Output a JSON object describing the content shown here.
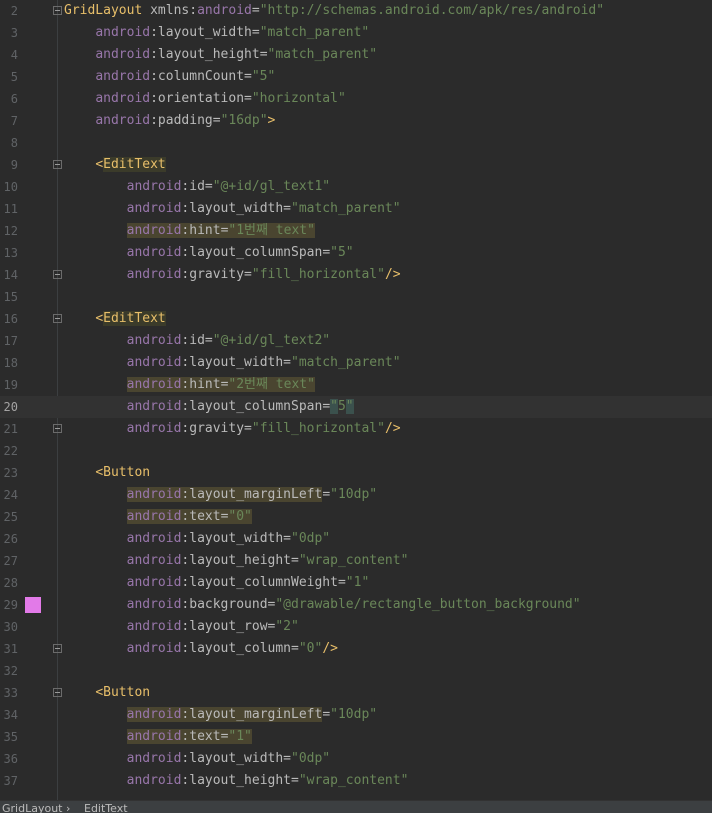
{
  "editor": {
    "lines": [
      {
        "n": "2",
        "fold": "open",
        "segs": [
          [
            "",
            "punc",
            "<"
          ],
          [
            "GridLayout",
            "tag",
            ""
          ],
          [
            " xmlns:",
            "attr",
            ""
          ],
          [
            "android",
            "ns",
            ""
          ],
          [
            "=",
            "attr",
            ""
          ],
          [
            "\"http://schemas.android.com/apk/res/android\"",
            "val",
            ""
          ]
        ]
      },
      {
        "n": "3",
        "segs": [
          [
            "    ",
            "",
            ""
          ],
          [
            "android",
            "ns",
            ""
          ],
          [
            ":layout_width",
            "attr",
            ""
          ],
          [
            "=",
            "attr",
            ""
          ],
          [
            "\"match_parent\"",
            "val",
            ""
          ]
        ]
      },
      {
        "n": "4",
        "segs": [
          [
            "    ",
            "",
            ""
          ],
          [
            "android",
            "ns",
            ""
          ],
          [
            ":layout_height",
            "attr",
            ""
          ],
          [
            "=",
            "attr",
            ""
          ],
          [
            "\"match_parent\"",
            "val",
            ""
          ]
        ]
      },
      {
        "n": "5",
        "segs": [
          [
            "    ",
            "",
            ""
          ],
          [
            "android",
            "ns",
            ""
          ],
          [
            ":columnCount",
            "attr",
            ""
          ],
          [
            "=",
            "attr",
            ""
          ],
          [
            "\"5\"",
            "val",
            ""
          ]
        ]
      },
      {
        "n": "6",
        "segs": [
          [
            "    ",
            "",
            ""
          ],
          [
            "android",
            "ns",
            ""
          ],
          [
            ":orientation",
            "attr",
            ""
          ],
          [
            "=",
            "attr",
            ""
          ],
          [
            "\"horizontal\"",
            "val",
            ""
          ]
        ]
      },
      {
        "n": "7",
        "segs": [
          [
            "    ",
            "",
            ""
          ],
          [
            "android",
            "ns",
            ""
          ],
          [
            ":padding",
            "attr",
            ""
          ],
          [
            "=",
            "attr",
            ""
          ],
          [
            "\"16dp\"",
            "val",
            ""
          ],
          [
            ">",
            "punc",
            ""
          ]
        ]
      },
      {
        "n": "8",
        "segs": []
      },
      {
        "n": "9",
        "fold": "open",
        "segs": [
          [
            "    ",
            "",
            ""
          ],
          [
            "<",
            "punc",
            ""
          ],
          [
            "EditText",
            "tag",
            "tag"
          ]
        ]
      },
      {
        "n": "10",
        "segs": [
          [
            "        ",
            "",
            ""
          ],
          [
            "android",
            "ns",
            ""
          ],
          [
            ":id",
            "attr",
            ""
          ],
          [
            "=",
            "attr",
            ""
          ],
          [
            "\"@+id/gl_text1\"",
            "val",
            ""
          ]
        ]
      },
      {
        "n": "11",
        "segs": [
          [
            "        ",
            "",
            ""
          ],
          [
            "android",
            "ns",
            ""
          ],
          [
            ":layout_width",
            "attr",
            ""
          ],
          [
            "=",
            "attr",
            ""
          ],
          [
            "\"match_parent\"",
            "val",
            ""
          ]
        ]
      },
      {
        "n": "12",
        "segs": [
          [
            "        ",
            "",
            ""
          ],
          [
            "android",
            "ns",
            "hl"
          ],
          [
            ":hint",
            "attr",
            "hl"
          ],
          [
            "=",
            "attr",
            "hl"
          ],
          [
            "\"1번째 text\"",
            "val",
            "hl"
          ]
        ]
      },
      {
        "n": "13",
        "segs": [
          [
            "        ",
            "",
            ""
          ],
          [
            "android",
            "ns",
            ""
          ],
          [
            ":layout_columnSpan",
            "attr",
            ""
          ],
          [
            "=",
            "attr",
            ""
          ],
          [
            "\"5\"",
            "val",
            ""
          ]
        ]
      },
      {
        "n": "14",
        "fold": "close",
        "segs": [
          [
            "        ",
            "",
            ""
          ],
          [
            "android",
            "ns",
            ""
          ],
          [
            ":gravity",
            "attr",
            ""
          ],
          [
            "=",
            "attr",
            ""
          ],
          [
            "\"fill_horizontal\"",
            "val",
            ""
          ],
          [
            "/>",
            "punc",
            ""
          ]
        ]
      },
      {
        "n": "15",
        "segs": []
      },
      {
        "n": "16",
        "fold": "open",
        "segs": [
          [
            "    ",
            "",
            ""
          ],
          [
            "<",
            "punc",
            ""
          ],
          [
            "EditText",
            "tag",
            "tag"
          ]
        ]
      },
      {
        "n": "17",
        "segs": [
          [
            "        ",
            "",
            ""
          ],
          [
            "android",
            "ns",
            ""
          ],
          [
            ":id",
            "attr",
            ""
          ],
          [
            "=",
            "attr",
            ""
          ],
          [
            "\"@+id/gl_text2\"",
            "val",
            ""
          ]
        ]
      },
      {
        "n": "18",
        "segs": [
          [
            "        ",
            "",
            ""
          ],
          [
            "android",
            "ns",
            ""
          ],
          [
            ":layout_width",
            "attr",
            ""
          ],
          [
            "=",
            "attr",
            ""
          ],
          [
            "\"match_parent\"",
            "val",
            ""
          ]
        ]
      },
      {
        "n": "19",
        "segs": [
          [
            "        ",
            "",
            ""
          ],
          [
            "android",
            "ns",
            "hl"
          ],
          [
            ":hint",
            "attr",
            "hl"
          ],
          [
            "=",
            "attr",
            "hl"
          ],
          [
            "\"2번째 text\"",
            "val",
            "hl"
          ]
        ]
      },
      {
        "n": "20",
        "current": true,
        "segs": [
          [
            "        ",
            "",
            ""
          ],
          [
            "android",
            "ns",
            ""
          ],
          [
            ":layout_columnSpan",
            "attr",
            ""
          ],
          [
            "=",
            "attr",
            ""
          ],
          [
            "\"",
            "val",
            "caret"
          ],
          [
            "5",
            "val",
            ""
          ],
          [
            "\"",
            "val",
            "caret"
          ]
        ]
      },
      {
        "n": "21",
        "fold": "close",
        "segs": [
          [
            "        ",
            "",
            ""
          ],
          [
            "android",
            "ns",
            ""
          ],
          [
            ":gravity",
            "attr",
            ""
          ],
          [
            "=",
            "attr",
            ""
          ],
          [
            "\"fill_horizontal\"",
            "val",
            ""
          ],
          [
            "/>",
            "punc",
            ""
          ]
        ]
      },
      {
        "n": "22",
        "segs": []
      },
      {
        "n": "23",
        "segs": [
          [
            "    ",
            "",
            ""
          ],
          [
            "<",
            "punc",
            ""
          ],
          [
            "Button",
            "tag",
            ""
          ]
        ]
      },
      {
        "n": "24",
        "segs": [
          [
            "        ",
            "",
            ""
          ],
          [
            "android",
            "ns",
            "hl"
          ],
          [
            ":layout_marginLeft",
            "attr",
            "hl"
          ],
          [
            "=",
            "attr",
            ""
          ],
          [
            "\"10dp\"",
            "val",
            ""
          ]
        ]
      },
      {
        "n": "25",
        "segs": [
          [
            "        ",
            "",
            ""
          ],
          [
            "android",
            "ns",
            "hl"
          ],
          [
            ":text",
            "attr",
            "hl"
          ],
          [
            "=",
            "attr",
            "hl"
          ],
          [
            "\"0\"",
            "val",
            "hl"
          ]
        ]
      },
      {
        "n": "26",
        "segs": [
          [
            "        ",
            "",
            ""
          ],
          [
            "android",
            "ns",
            ""
          ],
          [
            ":layout_width",
            "attr",
            ""
          ],
          [
            "=",
            "attr",
            ""
          ],
          [
            "\"0dp\"",
            "val",
            ""
          ]
        ]
      },
      {
        "n": "27",
        "segs": [
          [
            "        ",
            "",
            ""
          ],
          [
            "android",
            "ns",
            ""
          ],
          [
            ":layout_height",
            "attr",
            ""
          ],
          [
            "=",
            "attr",
            ""
          ],
          [
            "\"wrap_content\"",
            "val",
            ""
          ]
        ]
      },
      {
        "n": "28",
        "segs": [
          [
            "        ",
            "",
            ""
          ],
          [
            "android",
            "ns",
            ""
          ],
          [
            ":layout_columnWeight",
            "attr",
            ""
          ],
          [
            "=",
            "attr",
            ""
          ],
          [
            "\"1\"",
            "val",
            ""
          ]
        ]
      },
      {
        "n": "29",
        "marker": true,
        "segs": [
          [
            "        ",
            "",
            ""
          ],
          [
            "android",
            "ns",
            ""
          ],
          [
            ":background",
            "attr",
            ""
          ],
          [
            "=",
            "attr",
            ""
          ],
          [
            "\"@drawable/rectangle_button_background\"",
            "val",
            ""
          ]
        ]
      },
      {
        "n": "30",
        "segs": [
          [
            "        ",
            "",
            ""
          ],
          [
            "android",
            "ns",
            ""
          ],
          [
            ":layout_row",
            "attr",
            ""
          ],
          [
            "=",
            "attr",
            ""
          ],
          [
            "\"2\"",
            "val",
            ""
          ]
        ]
      },
      {
        "n": "31",
        "fold": "close",
        "segs": [
          [
            "        ",
            "",
            ""
          ],
          [
            "android",
            "ns",
            ""
          ],
          [
            ":layout_column",
            "attr",
            ""
          ],
          [
            "=",
            "attr",
            ""
          ],
          [
            "\"0\"",
            "val",
            ""
          ],
          [
            "/>",
            "punc",
            ""
          ]
        ]
      },
      {
        "n": "32",
        "segs": []
      },
      {
        "n": "33",
        "fold": "open",
        "segs": [
          [
            "    ",
            "",
            ""
          ],
          [
            "<",
            "punc",
            ""
          ],
          [
            "Button",
            "tag",
            ""
          ]
        ]
      },
      {
        "n": "34",
        "segs": [
          [
            "        ",
            "",
            ""
          ],
          [
            "android",
            "ns",
            "hl"
          ],
          [
            ":layout_marginLeft",
            "attr",
            "hl"
          ],
          [
            "=",
            "attr",
            ""
          ],
          [
            "\"10dp\"",
            "val",
            ""
          ]
        ]
      },
      {
        "n": "35",
        "segs": [
          [
            "        ",
            "",
            ""
          ],
          [
            "android",
            "ns",
            "hl"
          ],
          [
            ":text",
            "attr",
            "hl"
          ],
          [
            "=",
            "attr",
            "hl"
          ],
          [
            "\"1\"",
            "val",
            "hl"
          ]
        ]
      },
      {
        "n": "36",
        "segs": [
          [
            "        ",
            "",
            ""
          ],
          [
            "android",
            "ns",
            ""
          ],
          [
            ":layout_width",
            "attr",
            ""
          ],
          [
            "=",
            "attr",
            ""
          ],
          [
            "\"0dp\"",
            "val",
            ""
          ]
        ]
      },
      {
        "n": "37",
        "segs": [
          [
            "        ",
            "",
            ""
          ],
          [
            "android",
            "ns",
            ""
          ],
          [
            ":layout_height",
            "attr",
            ""
          ],
          [
            "=",
            "attr",
            ""
          ],
          [
            "\"wrap_content\"",
            "val",
            ""
          ]
        ]
      }
    ],
    "marker_color": "#e27ae8"
  },
  "breadcrumbs": {
    "items": [
      "GridLayout",
      "EditText"
    ],
    "separator": "›"
  }
}
